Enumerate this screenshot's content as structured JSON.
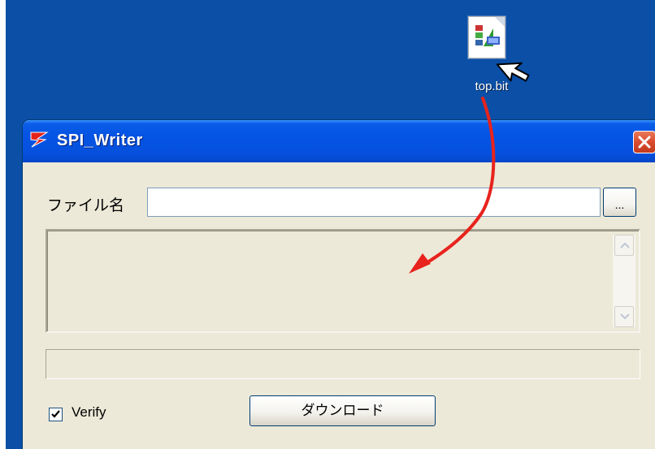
{
  "desktop": {
    "background": "#0b4fa6",
    "file_icon": {
      "label": "top.bit",
      "icon": "bit-file-icon"
    },
    "cursor_icon": "arrow-cursor-icon"
  },
  "window": {
    "title": "SPI_Writer",
    "title_icon": "spi-writer-app-icon",
    "close_icon": "close-icon",
    "titlebar_color": "#0554e4",
    "close_color": "#d94b2e"
  },
  "form": {
    "filename_label": "ファイル名",
    "filename_value": "",
    "filename_placeholder": "",
    "browse_label": "...",
    "log_text": "",
    "progress": 0,
    "verify_label": "Verify",
    "verify_checked": true,
    "download_label": "ダウンロード"
  },
  "annotation": {
    "arrow_color": "#e8231d",
    "meaning": "drag-file-into-window"
  }
}
